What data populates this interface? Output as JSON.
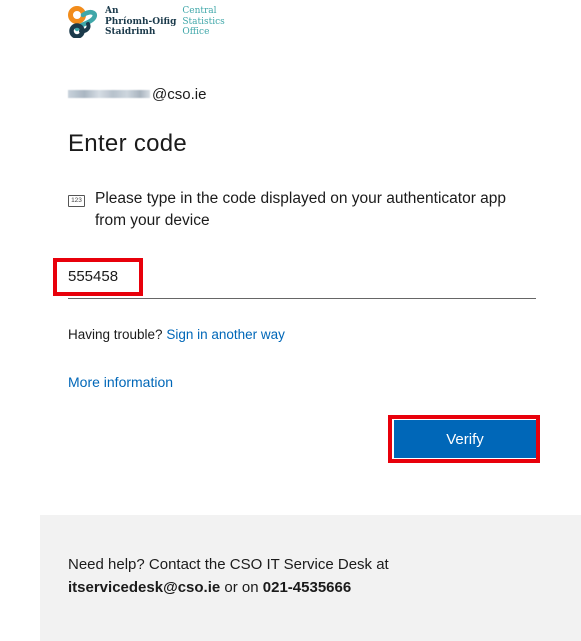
{
  "logo": {
    "irish_lines": [
      "An",
      "Phríomh-Oifig",
      "Staidrimh"
    ],
    "english_lines": [
      "Central",
      "Statistics",
      "Office"
    ],
    "colors": {
      "orange": "#f28c1b",
      "teal": "#3fa7a9",
      "navy": "#1b3a4b"
    }
  },
  "identity": {
    "email_suffix": "@cso.ie"
  },
  "title": "Enter code",
  "instruction": {
    "icon": "123",
    "text": "Please type in the code displayed on your authenticator app from your device"
  },
  "code_field": {
    "value": "555458"
  },
  "trouble": {
    "prefix": "Having trouble? ",
    "link": "Sign in another way"
  },
  "more_info": "More information",
  "verify_label": "Verify",
  "footer": {
    "line1": "Need help? Contact the CSO IT Service Desk at",
    "email": "itservicedesk@cso.ie",
    "or_text": " or on ",
    "phone": "021-4535666"
  },
  "colors": {
    "accent": "#0067b8",
    "highlight": "#e8000b",
    "footer_bg": "#f2f2f2"
  }
}
